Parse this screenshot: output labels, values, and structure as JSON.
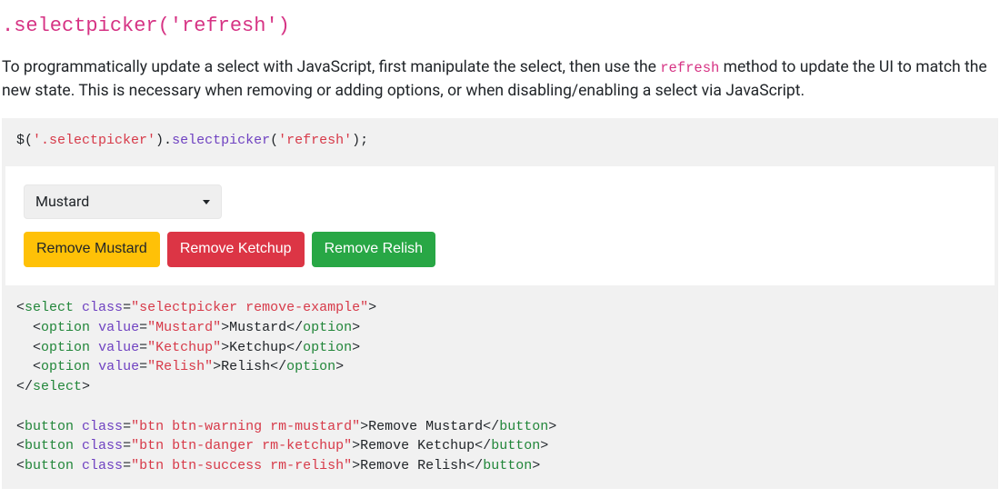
{
  "title": ".selectpicker('refresh')",
  "description": {
    "pre": "To programmatically update a select with JavaScript, first manipulate the select, then use the ",
    "code": "refresh",
    "post": " method to update the UI to match the new state. This is necessary when removing or adding options, or when disabling/enabling a select via JavaScript."
  },
  "code1": {
    "selector": "'.selectpicker'",
    "method": "selectpicker",
    "arg": "'refresh'"
  },
  "example": {
    "selected": "Mustard",
    "buttons": [
      {
        "label": "Remove Mustard",
        "variant": "warning"
      },
      {
        "label": "Remove Ketchup",
        "variant": "danger"
      },
      {
        "label": "Remove Relish",
        "variant": "success"
      }
    ]
  },
  "code2": {
    "select": {
      "class_attr": "\"selectpicker remove-example\"",
      "options": [
        {
          "value": "\"Mustard\"",
          "text": "Mustard"
        },
        {
          "value": "\"Ketchup\"",
          "text": "Ketchup"
        },
        {
          "value": "\"Relish\"",
          "text": "Relish"
        }
      ]
    },
    "buttons": [
      {
        "class_attr": "\"btn btn-warning rm-mustard\"",
        "text": "Remove Mustard"
      },
      {
        "class_attr": "\"btn btn-danger rm-ketchup\"",
        "text": "Remove Ketchup"
      },
      {
        "class_attr": "\"btn btn-success rm-relish\"",
        "text": "Remove Relish"
      }
    ]
  }
}
